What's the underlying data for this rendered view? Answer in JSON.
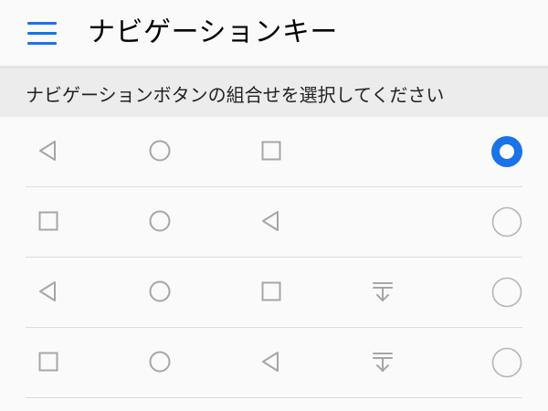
{
  "header": {
    "title": "ナビゲーションキー",
    "menu_icon": "menu-icon",
    "accent_color": "#1a73e8"
  },
  "section": {
    "label": "ナビゲーションボタンの組合せを選択してください"
  },
  "options": [
    {
      "buttons": [
        "back-icon",
        "home-icon",
        "recents-icon"
      ],
      "selected": true
    },
    {
      "buttons": [
        "recents-icon",
        "home-icon",
        "back-icon"
      ],
      "selected": false
    },
    {
      "buttons": [
        "back-icon",
        "home-icon",
        "recents-icon",
        "notification-pulldown-icon"
      ],
      "selected": false
    },
    {
      "buttons": [
        "recents-icon",
        "home-icon",
        "back-icon",
        "notification-pulldown-icon"
      ],
      "selected": false
    }
  ]
}
